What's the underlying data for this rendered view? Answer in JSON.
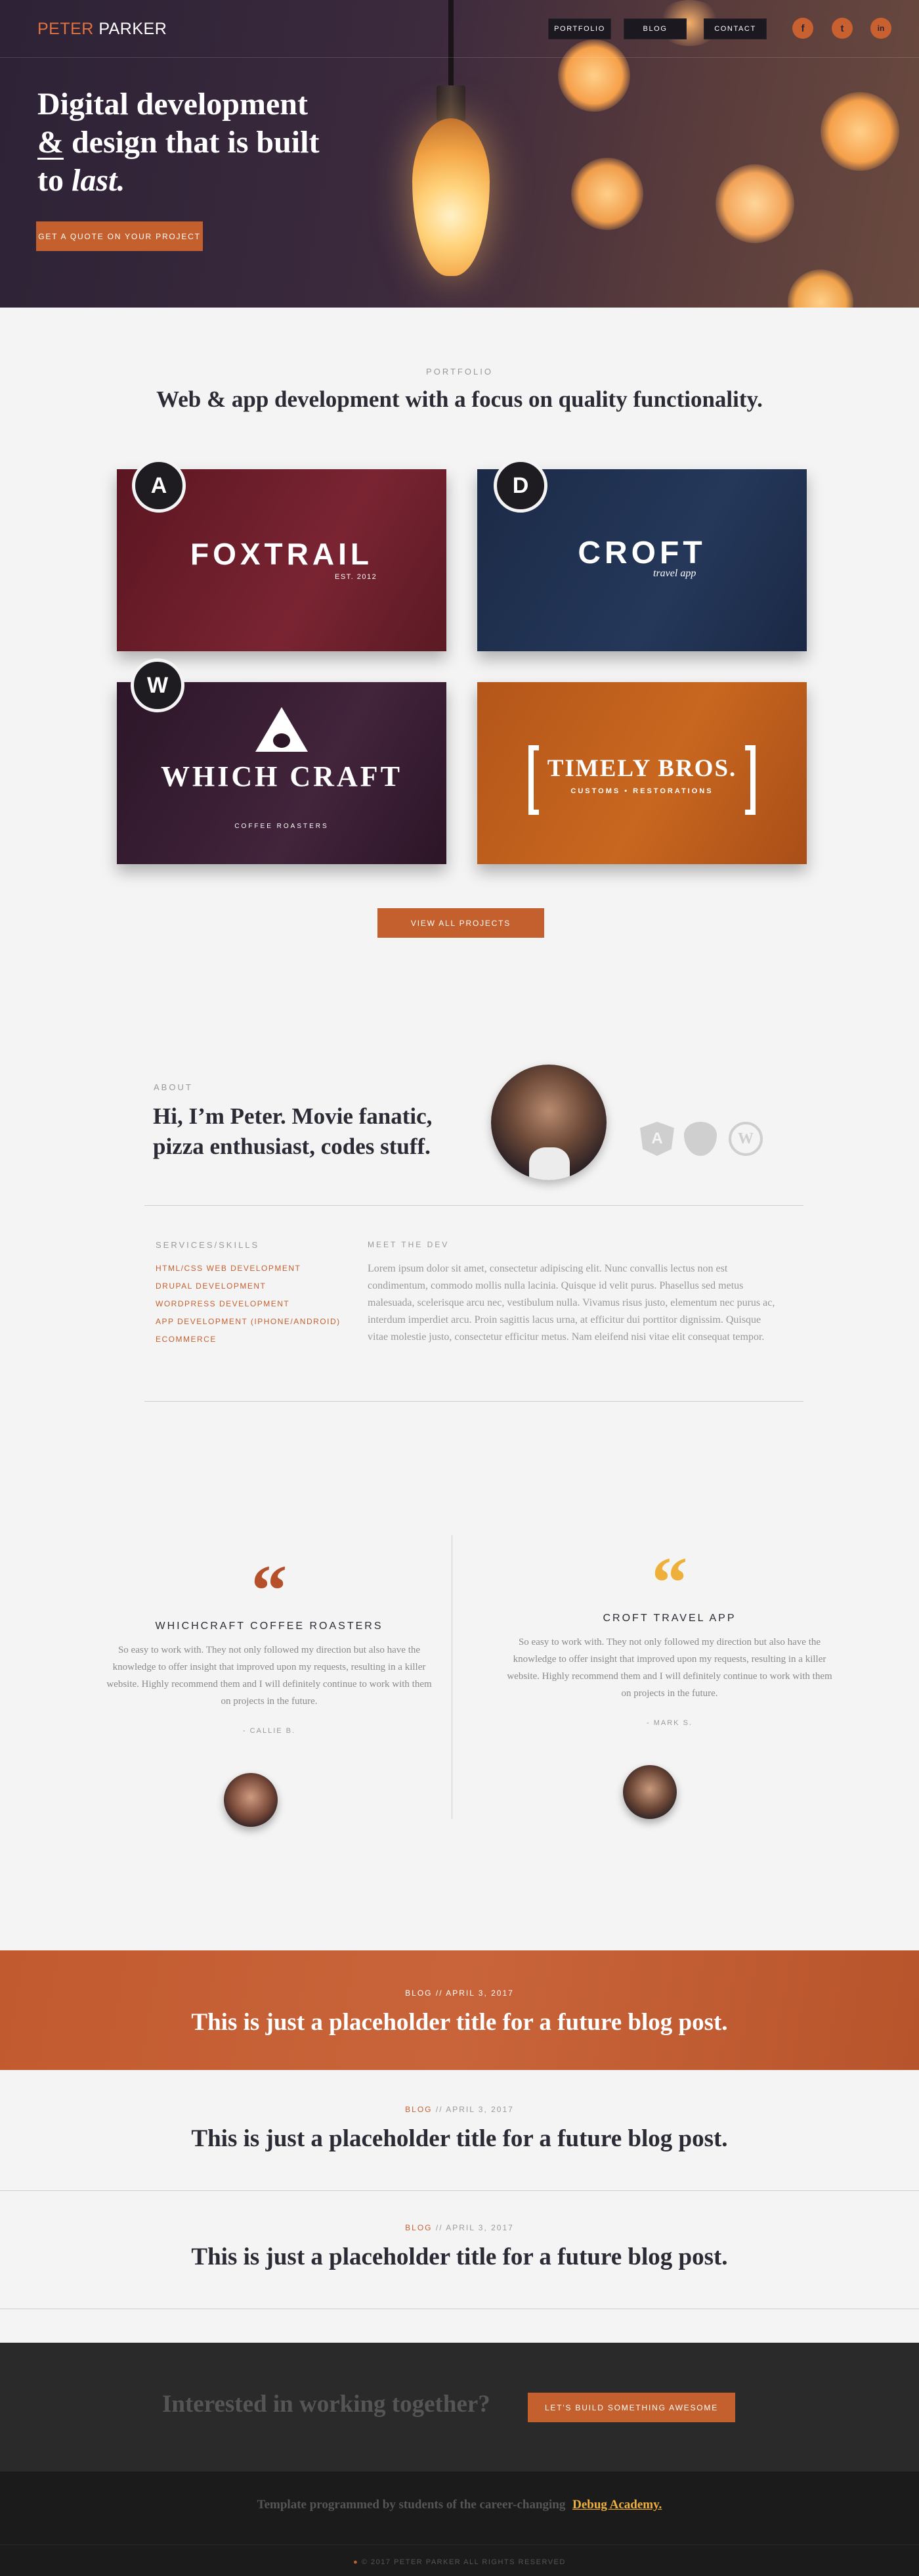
{
  "header": {
    "logo_first": "PETER",
    "logo_last": "PARKER",
    "nav": [
      "PORTFOLIO",
      "BLOG",
      "CONTACT"
    ],
    "social": [
      {
        "icon": "facebook-icon",
        "glyph": "f"
      },
      {
        "icon": "twitter-icon",
        "glyph": "t"
      },
      {
        "icon": "linkedin-icon",
        "glyph": "in"
      }
    ]
  },
  "hero": {
    "line1": "Digital development",
    "amp": "&",
    "line2_rest": " design that is built",
    "line3": "to ",
    "last": "last.",
    "cta": "GET A QUOTE ON YOUR PROJECT"
  },
  "portfolio": {
    "kicker": "PORTFOLIO",
    "heading": "Web & app development with a focus on quality functionality.",
    "projects": [
      {
        "title": "FOXTRAIL",
        "sub": "EST. 2012",
        "badge_icon": "angular-icon",
        "badge": "A",
        "color": "#6b1e2a"
      },
      {
        "title": "CROFT",
        "sub": "travel app",
        "badge_icon": "drupal-icon",
        "badge": "D",
        "color": "#213250"
      },
      {
        "title": "WHICH CRAFT",
        "sub": "COFFEE ROASTERS",
        "badge_icon": "wordpress-icon",
        "badge": "W",
        "color": "#3a1e35"
      },
      {
        "title": "TIMELY BROS.",
        "sub": "CUSTOMS • RESTORATIONS",
        "badge_icon": "",
        "badge": "",
        "color": "#c06018"
      }
    ],
    "view_all": "VIEW ALL PROJECTS"
  },
  "about": {
    "kicker": "ABOUT",
    "heading_1": "Hi, I’m Peter. Movie fanatic,",
    "heading_2": "pizza enthusiast, codes stuff.",
    "tech_icons": [
      "angular-icon",
      "drupal-icon",
      "wordpress-icon"
    ],
    "skills_title": "SERVICES/SKILLS",
    "skills": [
      "HTML/CSS WEB DEVELOPMENT",
      "DRUPAL DEVELOPMENT",
      "WORDPRESS DEVELOPMENT",
      "APP DEVELOPMENT (IPHONE/ANDROID)",
      "ECOMMERCE"
    ],
    "dev_title": "MEET THE DEV",
    "dev_text": "Lorem ipsum dolor sit amet, consectetur adipiscing elit. Nunc convallis lectus non est condimentum, commodo mollis nulla lacinia. Quisque id velit purus. Phasellus sed metus malesuada, scelerisque arcu nec, vestibulum nulla. Vivamus risus justo, elementum nec purus ac, interdum imperdiet arcu. Proin sagittis lacus urna, at efficitur dui porttitor dignissim. Quisque vitae molestie justo, consectetur efficitur metus. Nam eleifend nisi vitae elit consequat tempor."
  },
  "testimonials": [
    {
      "company": "WHICHCRAFT COFFEE ROASTERS",
      "text": "So easy to work with. They not only followed my direction but also have the knowledge to offer insight that improved upon my requests, resulting in a killer website. Highly recommend them and I will definitely continue to work with them on projects in the future.",
      "author": "- CALLIE B.",
      "quote_color": "#b5502b"
    },
    {
      "company": "CROFT TRAVEL APP",
      "text": "So easy to work with. They not only followed my direction but also have the knowledge to offer insight that improved upon my requests, resulting in a killer website. Highly recommend them and I will definitely continue to work with them on projects in the future.",
      "author": "- MARK S.",
      "quote_color": "#eeb03a"
    }
  ],
  "blog": [
    {
      "category": "BLOG",
      "date": "APRIL 3, 2017",
      "title": "This is just a placeholder title for a future blog post."
    },
    {
      "category": "BLOG",
      "date": "APRIL 3, 2017",
      "title": "This is just a placeholder title for a future blog post."
    },
    {
      "category": "BLOG",
      "date": "APRIL 3, 2017",
      "title": "This is just a placeholder title for a future blog post."
    }
  ],
  "cta": {
    "text": "Interested in working together?",
    "button": "LET'S BUILD SOMETHING AWESOME"
  },
  "footer": {
    "credit_text": "Template programmed by students of the career-changing",
    "credit_link": "Debug Academy.",
    "copyright": "© 2017 PETER PARKER ALL RIGHTS RESERVED"
  },
  "colors": {
    "accent": "#c45f2e",
    "dark": "#2b2b35",
    "footer": "#1b1b1b"
  }
}
